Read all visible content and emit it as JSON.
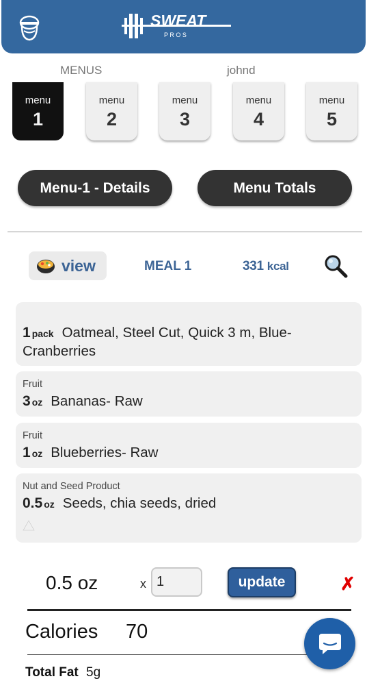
{
  "header": {
    "logo_text": "SWEAT",
    "logo_subtext": "P R O S"
  },
  "subheader": {
    "menus_label": "MENUS",
    "username": "johnd"
  },
  "menu_tabs": [
    {
      "word": "menu",
      "number": "1",
      "active": true
    },
    {
      "word": "menu",
      "number": "2",
      "active": false
    },
    {
      "word": "menu",
      "number": "3",
      "active": false
    },
    {
      "word": "menu",
      "number": "4",
      "active": false
    },
    {
      "word": "menu",
      "number": "5",
      "active": false
    }
  ],
  "actions": {
    "details_label": "Menu-1 - Details",
    "totals_label": "Menu Totals"
  },
  "meal_bar": {
    "view_label": "view",
    "meal_label": "MEAL 1",
    "kcal_value": "331",
    "kcal_unit": "kcal"
  },
  "foods": [
    {
      "category": "",
      "qty": "1",
      "unit": "pack",
      "name": "Oatmeal, Steel Cut, Quick 3 m, Blue-",
      "name_cont": "Cranberries"
    },
    {
      "category": "Fruit",
      "qty": "3",
      "unit": "oz",
      "name": "Bananas- Raw"
    },
    {
      "category": "Fruit",
      "qty": "1",
      "unit": "oz",
      "name": "Blueberries- Raw"
    },
    {
      "category": "Nut and Seed Product",
      "qty": "0.5",
      "unit": "oz",
      "name": "Seeds, chia seeds, dried"
    }
  ],
  "serving_editor": {
    "amount": "0.5 oz",
    "times": "x",
    "multiplier_value": "1",
    "update_label": "update",
    "remove_symbol": "✗"
  },
  "nutrition": {
    "calories_label": "Calories",
    "calories_value": "70",
    "total_fat_label": "Total Fat",
    "total_fat_value": "5g"
  },
  "colors": {
    "header": "#34689f",
    "accent_text": "#3c6495",
    "pill": "#333333",
    "update": "#2f5f9c",
    "remove": "#e00000",
    "chat": "#1f5fa8"
  },
  "icons": {
    "profile": "profile-icon",
    "view": "meal-bowl-icon",
    "search": "search-icon",
    "triangle": "warning-triangle-icon",
    "chat": "chat-icon"
  }
}
